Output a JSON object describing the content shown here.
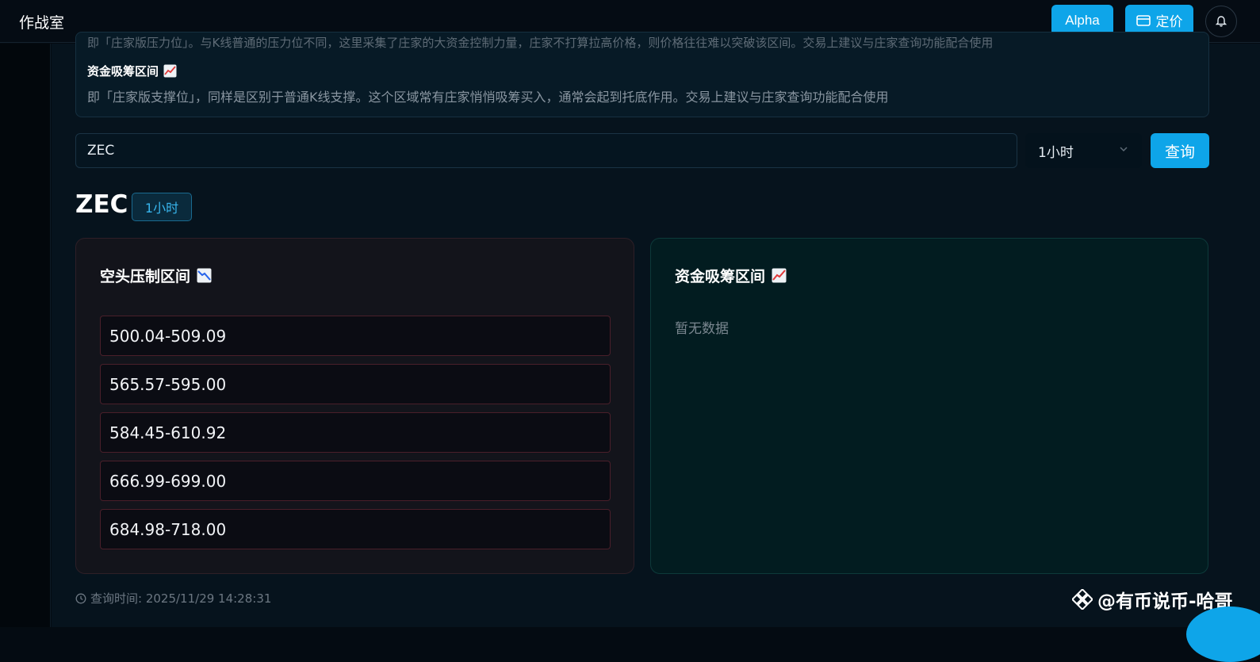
{
  "header": {
    "title": "作战室",
    "alpha_label": "Alpha",
    "pricing_label": "定价"
  },
  "info": {
    "cut_line": "即「庄家版压力位」。与K线普通的压力位不同，这里采集了庄家的大资金控制力量，庄家不打算拉高价格，则价格往往难以突破该区间。交易上建议与庄家查询功能配合使用",
    "title": "资金吸筹区间",
    "title_icon": "chart-increasing-icon",
    "desc": "即「庄家版支撑位」，同样是区别于普通K线支撑。这个区域常有庄家悄悄吸筹买入，通常会起到托底作用。交易上建议与庄家查询功能配合使用"
  },
  "search": {
    "value": "ZEC",
    "timeframe": "1小时",
    "query_label": "查询"
  },
  "result": {
    "symbol": "ZEC",
    "timeframe_badge": "1小时"
  },
  "pressure_panel": {
    "title": "空头压制区间",
    "icon": "chart-decreasing-icon",
    "ranges": [
      "500.04-509.09",
      "565.57-595.00",
      "584.45-610.92",
      "666.99-699.00",
      "684.98-718.00"
    ]
  },
  "accumulation_panel": {
    "title": "资金吸筹区间",
    "icon": "chart-increasing-icon",
    "empty_text": "暂无数据"
  },
  "footer": {
    "query_time": "查询时间: 2025/11/29 14:28:31"
  },
  "watermark": {
    "text": "@有币说币-哈哥"
  },
  "colors": {
    "accent": "#0ea5e9",
    "pressure_border": "#4a1f2a",
    "accumulation_bg": "#021c20"
  }
}
